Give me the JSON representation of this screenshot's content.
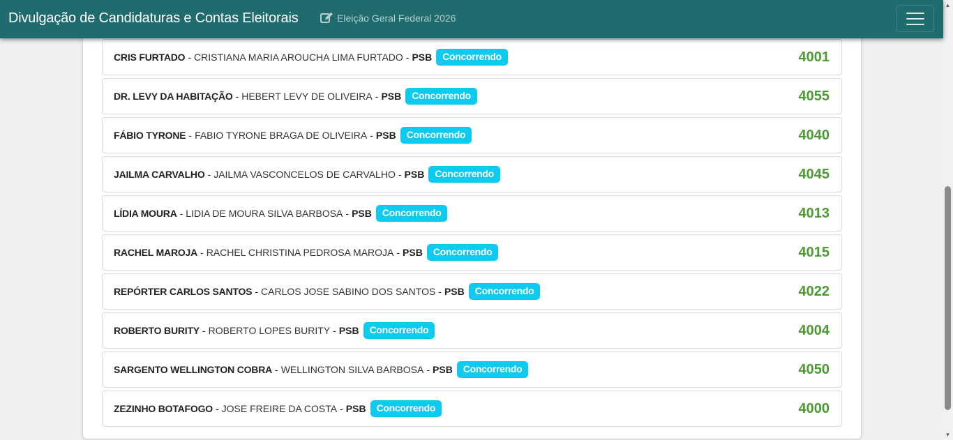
{
  "header": {
    "title": "Divulgação de Candidaturas e Contas Eleitorais",
    "election": "Eleição Geral Federal 2026",
    "edit_icon": "edit-icon",
    "menu_icon": "hamburger-menu-icon"
  },
  "colors": {
    "navbar": "#1f6b6e",
    "badge": "#0dcaf0",
    "number": "#4a9a34"
  },
  "candidates": [
    {
      "urna": "CRIS FURTADO",
      "nome": "CRISTIANA MARIA AROUCHA LIMA FURTADO",
      "partido": "PSB",
      "status": "Concorrendo",
      "numero": "4001"
    },
    {
      "urna": "DR. LEVY DA HABITAÇÃO",
      "nome": "HEBERT LEVY DE OLIVEIRA",
      "partido": "PSB",
      "status": "Concorrendo",
      "numero": "4055"
    },
    {
      "urna": "FÁBIO TYRONE",
      "nome": "FABIO TYRONE BRAGA DE OLIVEIRA",
      "partido": "PSB",
      "status": "Concorrendo",
      "numero": "4040"
    },
    {
      "urna": "JAILMA CARVALHO",
      "nome": "JAILMA VASCONCELOS DE CARVALHO",
      "partido": "PSB",
      "status": "Concorrendo",
      "numero": "4045"
    },
    {
      "urna": "LÍDIA MOURA",
      "nome": "LIDIA DE MOURA SILVA BARBOSA",
      "partido": "PSB",
      "status": "Concorrendo",
      "numero": "4013"
    },
    {
      "urna": "RACHEL MAROJA",
      "nome": "RACHEL CHRISTINA PEDROSA MAROJA",
      "partido": "PSB",
      "status": "Concorrendo",
      "numero": "4015"
    },
    {
      "urna": "REPÓRTER CARLOS SANTOS",
      "nome": "CARLOS JOSE SABINO DOS SANTOS",
      "partido": "PSB",
      "status": "Concorrendo",
      "numero": "4022"
    },
    {
      "urna": "ROBERTO BURITY",
      "nome": "ROBERTO LOPES BURITY",
      "partido": "PSB",
      "status": "Concorrendo",
      "numero": "4004"
    },
    {
      "urna": "SARGENTO WELLINGTON COBRA",
      "nome": "WELLINGTON SILVA BARBOSA",
      "partido": "PSB",
      "status": "Concorrendo",
      "numero": "4050"
    },
    {
      "urna": "ZEZINHO BOTAFOGO",
      "nome": "JOSE FREIRE DA COSTA",
      "partido": "PSB",
      "status": "Concorrendo",
      "numero": "4000"
    }
  ]
}
